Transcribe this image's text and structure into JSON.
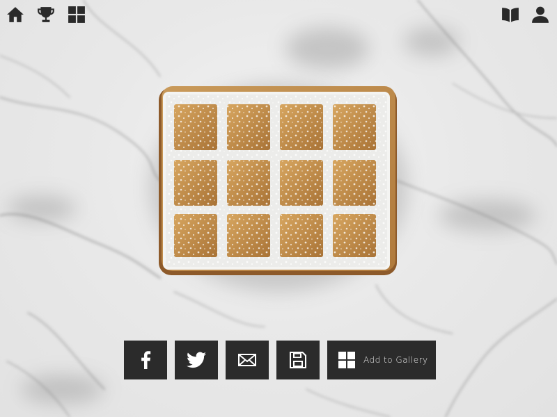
{
  "top_bar": {
    "left_icons": [
      "home-icon",
      "trophy-icon",
      "grid-icon"
    ],
    "right_icons": [
      "book-icon",
      "profile-icon"
    ]
  },
  "photo": {
    "subject": "waffle-image"
  },
  "share_bar": {
    "buttons": [
      "facebook-icon",
      "twitter-icon",
      "email-icon",
      "save-icon"
    ],
    "add_to_gallery_label": "Add to Gallery"
  },
  "colors": {
    "icon": "#2a2a2a",
    "button_bg": "#2b2b2b",
    "button_fg": "#ffffff",
    "marble_bg": "#ececec"
  }
}
